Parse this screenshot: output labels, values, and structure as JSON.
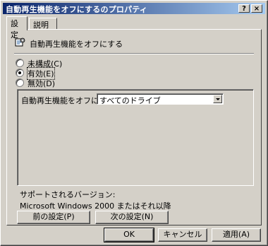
{
  "window": {
    "title": "自動再生機能をオフにするのプロパティ",
    "help_label": "?",
    "close_label": "×"
  },
  "tabs": [
    {
      "label": "設定"
    },
    {
      "label": "説明"
    }
  ],
  "policy": {
    "name": "自動再生機能をオフにする"
  },
  "state": {
    "options": [
      {
        "label": "未構成(C)",
        "checked": false
      },
      {
        "label": "有効(E)",
        "checked": true
      },
      {
        "label": "無効(D)",
        "checked": false
      }
    ]
  },
  "options": {
    "label": "自動再生機能をオフにする:",
    "selected": "すべてのドライブ"
  },
  "supported": {
    "label": "サポートされるバージョン:",
    "value": "Microsoft Windows 2000 またはそれ以降"
  },
  "nav": {
    "prev_label": "前の設定(P)",
    "next_label": "次の設定(N)"
  },
  "footer": {
    "ok_label": "OK",
    "cancel_label": "キャンセル",
    "apply_label": "適用(A)"
  }
}
